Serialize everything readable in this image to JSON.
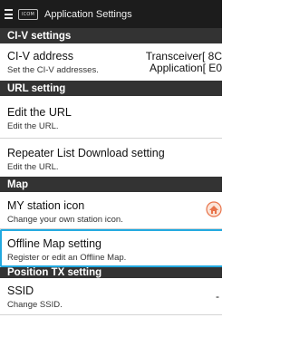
{
  "appbar": {
    "logo_text": "ICOM",
    "title": "Application Settings"
  },
  "sections": {
    "civ": "CI-V settings",
    "url": "URL setting",
    "map": "Map",
    "position_tx": "Position TX setting"
  },
  "rows": {
    "civ_address": {
      "title": "CI-V address",
      "subtitle": "Set the CI-V addresses.",
      "value_line1": "Transceiver[ 8C",
      "value_line2": "Application[ E0"
    },
    "edit_url": {
      "title": "Edit the URL",
      "subtitle": "Edit the URL."
    },
    "repeater_list": {
      "title": "Repeater List Download setting",
      "subtitle": "Edit the URL."
    },
    "my_station_icon": {
      "title": "MY station icon",
      "subtitle": "Change your own station icon.",
      "icon": "station-icon"
    },
    "offline_map": {
      "title": "Offline Map setting",
      "subtitle": "Register or edit an Offline Map.",
      "highlighted": true
    },
    "ssid": {
      "title": "SSID",
      "subtitle": "Change SSID.",
      "value": "-"
    }
  },
  "colors": {
    "appbar": "#1c1c1c",
    "section": "#333333",
    "highlight": "#22a9e0",
    "icon": "#e8734a"
  }
}
